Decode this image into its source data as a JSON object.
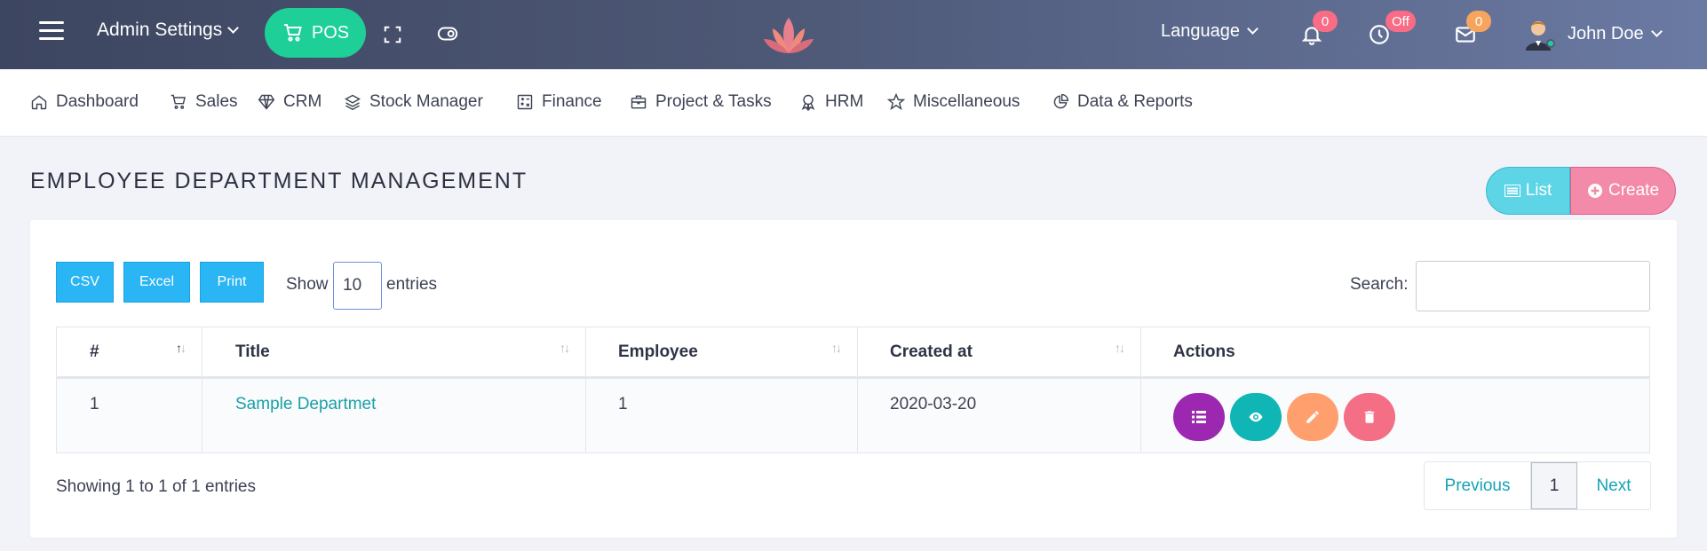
{
  "topbar": {
    "admin_settings": "Admin Settings",
    "pos_label": "POS",
    "language_label": "Language",
    "notifications_count": "0",
    "clock_badge": "Off",
    "messages_count": "0",
    "user_name": "John Doe",
    "colors": {
      "pos": "#1fcf98",
      "badge": "#f86c86",
      "badge_orange": "#f7a45f"
    }
  },
  "nav": {
    "items": [
      {
        "label": "Dashboard",
        "icon": "home-icon"
      },
      {
        "label": "Sales",
        "icon": "cart-icon"
      },
      {
        "label": "CRM",
        "icon": "diamond-icon"
      },
      {
        "label": "Stock Manager",
        "icon": "layers-icon"
      },
      {
        "label": "Finance",
        "icon": "calculator-icon"
      },
      {
        "label": "Project & Tasks",
        "icon": "briefcase-icon"
      },
      {
        "label": "HRM",
        "icon": "award-icon"
      },
      {
        "label": "Miscellaneous",
        "icon": "star-icon"
      },
      {
        "label": "Data & Reports",
        "icon": "pie-chart-icon"
      }
    ]
  },
  "page": {
    "title": "EMPLOYEE DEPARTMENT MANAGEMENT",
    "list_label": "List",
    "create_label": "Create"
  },
  "table_controls": {
    "csv": "CSV",
    "excel": "Excel",
    "print": "Print",
    "show": "Show",
    "page_size": "10",
    "entries": "entries",
    "search_label": "Search:",
    "search_value": ""
  },
  "table": {
    "headers": [
      "#",
      "Title",
      "Employee",
      "Created at",
      "Actions"
    ],
    "rows": [
      {
        "num": "1",
        "title": "Sample Departmet",
        "employee": "1",
        "created_at": "2020-03-20"
      }
    ],
    "action_colors": [
      "#9c27b0",
      "#10b5b5",
      "#ff9f6e",
      "#f46e85"
    ]
  },
  "footer": {
    "showing": "Showing 1 to 1 of 1 entries",
    "previous": "Previous",
    "current_page": "1",
    "next": "Next"
  }
}
